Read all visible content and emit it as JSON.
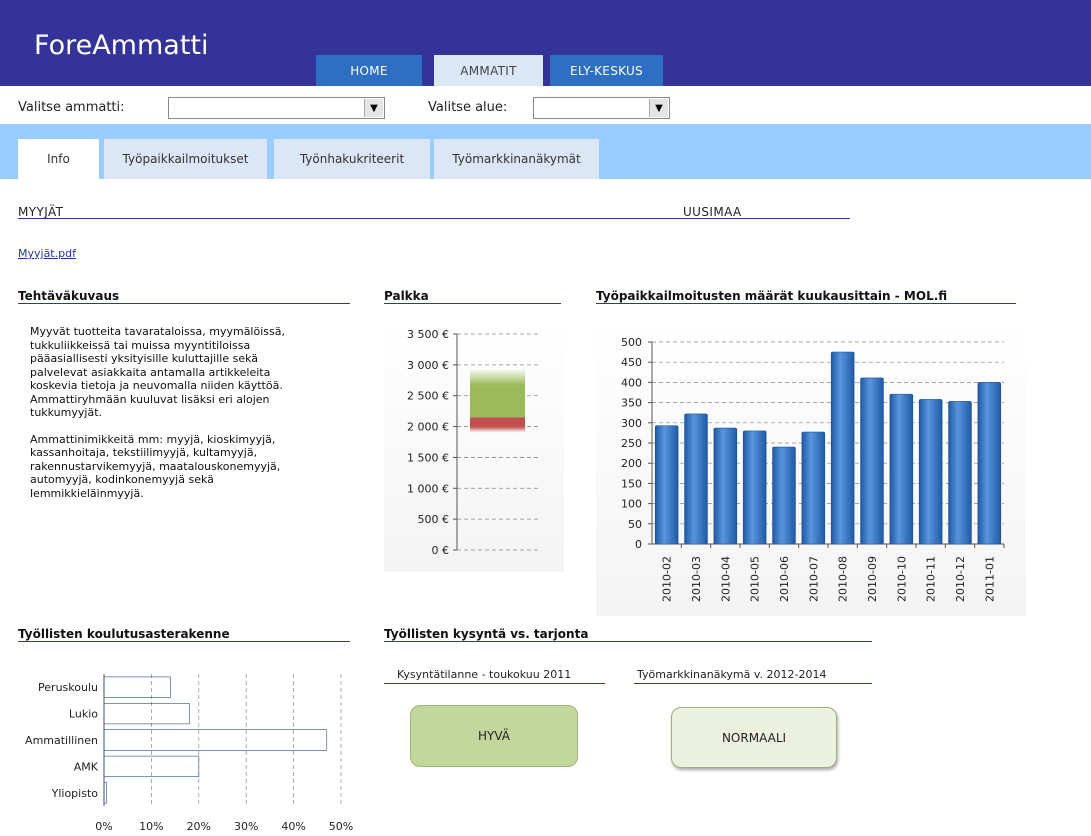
{
  "header": {
    "brand": "ForeAmmatti",
    "nav": [
      {
        "label": "HOME"
      },
      {
        "label": "AMMATIT"
      },
      {
        "label": "ELY-KESKUS"
      }
    ]
  },
  "selectors": {
    "occupation_label": "Valitse ammatti:",
    "occupation_value": "",
    "region_label": "Valitse alue:",
    "region_value": ""
  },
  "tabs": [
    {
      "label": "Info"
    },
    {
      "label": "Työpaikkailmoitukset"
    },
    {
      "label": "Työnhakukriteerit"
    },
    {
      "label": "Työmarkkinanäkymät"
    }
  ],
  "main": {
    "occupation": "MYYJÄT",
    "region": "UUSIMAA",
    "pdf_link": "Myyjät.pdf"
  },
  "job_description": {
    "title": "Tehtäväkuvaus",
    "lines_p1": [
      "Myyvät tuotteita tavarataloissa, myymälöissä,",
      "tukkuliikkeissä tai muissa myyntitiloissa",
      "pääasiallisesti yksityisille kuluttajille sekä",
      "palvelevat asiakkaita antamalla artikkeleita",
      "koskevia tietoja ja neuvomalla niiden käyttöä.",
      "Ammattiryhmään kuuluvat lisäksi eri alojen",
      "tukkumyyjät."
    ],
    "lines_p2": [
      "Ammattinimikkeitä mm: myyjä, kioskimyyjä,",
      "kassanhoitaja, tekstiilimyyjä, kultamyyjä,",
      "rakennustarvikemyyjä, maatalouskonemyyjä,",
      "automyyjä, kodinkonemyyjä sekä",
      "lemmikkieläinmyyjä."
    ]
  },
  "salary": {
    "title": "Palkka",
    "chart_data": {
      "type": "bar",
      "ticks": [
        "3 500 €",
        "3 000 €",
        "2 500 €",
        "2 000 €",
        "1 500 €",
        "1 000 €",
        "500 €",
        "0 €"
      ],
      "ylim": [
        0,
        3500
      ],
      "ranges": [
        {
          "from": 1900,
          "to": 2150,
          "color": "#c0504d"
        },
        {
          "from": 2150,
          "to": 2950,
          "color": "#9bbb59"
        }
      ]
    }
  },
  "job_ads": {
    "title": "Työpaikkailmoitusten määrät kuukausittain - MOL.fi",
    "chart_data": {
      "type": "bar",
      "categories": [
        "2010-02",
        "2010-03",
        "2010-04",
        "2010-05",
        "2010-06",
        "2010-07",
        "2010-08",
        "2010-09",
        "2010-10",
        "2010-11",
        "2010-12",
        "2011-01"
      ],
      "values": [
        293,
        322,
        287,
        280,
        240,
        277,
        475,
        411,
        371,
        358,
        353,
        400
      ],
      "ylim": [
        0,
        500
      ],
      "yticks": [
        0,
        50,
        100,
        150,
        200,
        250,
        300,
        350,
        400,
        450,
        500
      ],
      "color": "#2f6fc3"
    }
  },
  "education": {
    "title": "Työllisten koulutusasterakenne",
    "chart_data": {
      "type": "bar",
      "orientation": "horizontal",
      "categories": [
        "Peruskoulu",
        "Lukio",
        "Ammatillinen",
        "AMK",
        "Yliopisto"
      ],
      "values": [
        14,
        18,
        47,
        20,
        0.5
      ],
      "xlim": [
        0,
        50
      ],
      "xticks": [
        "0%",
        "10%",
        "20%",
        "30%",
        "40%",
        "50%"
      ],
      "color": "#2f6fc3"
    }
  },
  "supply_demand": {
    "title": "Työllisten kysyntä vs. tarjonta",
    "demand_label": "Kysyntätilanne - toukokuu 2011",
    "demand_value": "HYVÄ",
    "demand_color": "#c3d69b",
    "outlook_label": "Työmarkkinanäkymä v. 2012-2014",
    "outlook_value": "NORMAALI",
    "outlook_color": "#ebf1de"
  }
}
